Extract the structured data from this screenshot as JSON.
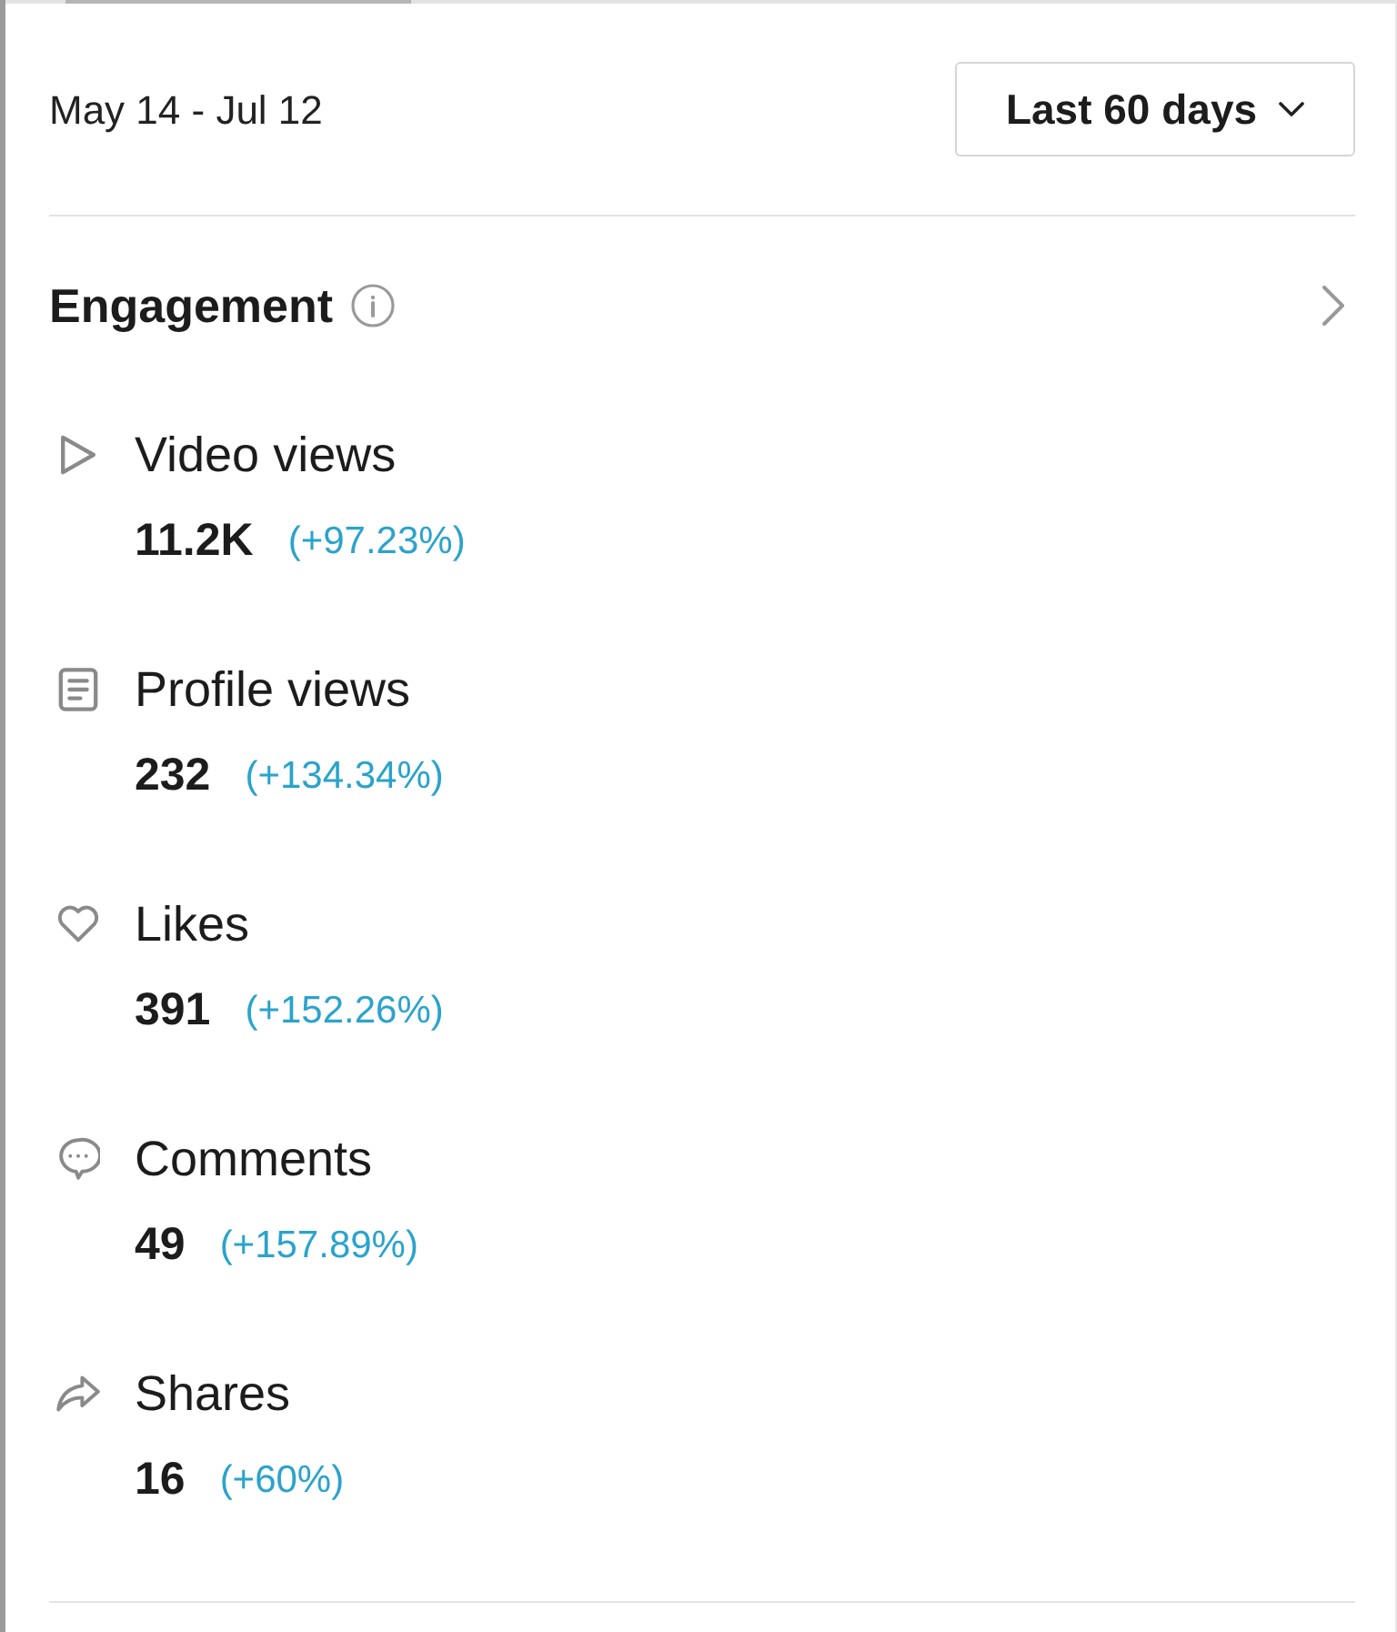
{
  "date_range": "May 14 - Jul 12",
  "period_dropdown": {
    "label": "Last 60 days"
  },
  "section": {
    "title": "Engagement"
  },
  "metrics": [
    {
      "kind": "play",
      "label": "Video views",
      "value": "11.2K",
      "change": "(+97.23%)"
    },
    {
      "kind": "profile",
      "label": "Profile views",
      "value": "232",
      "change": "(+134.34%)"
    },
    {
      "kind": "likes",
      "label": "Likes",
      "value": "391",
      "change": "(+152.26%)"
    },
    {
      "kind": "comments",
      "label": "Comments",
      "value": "49",
      "change": "(+157.89%)"
    },
    {
      "kind": "shares",
      "label": "Shares",
      "value": "16",
      "change": "(+60%)"
    }
  ]
}
